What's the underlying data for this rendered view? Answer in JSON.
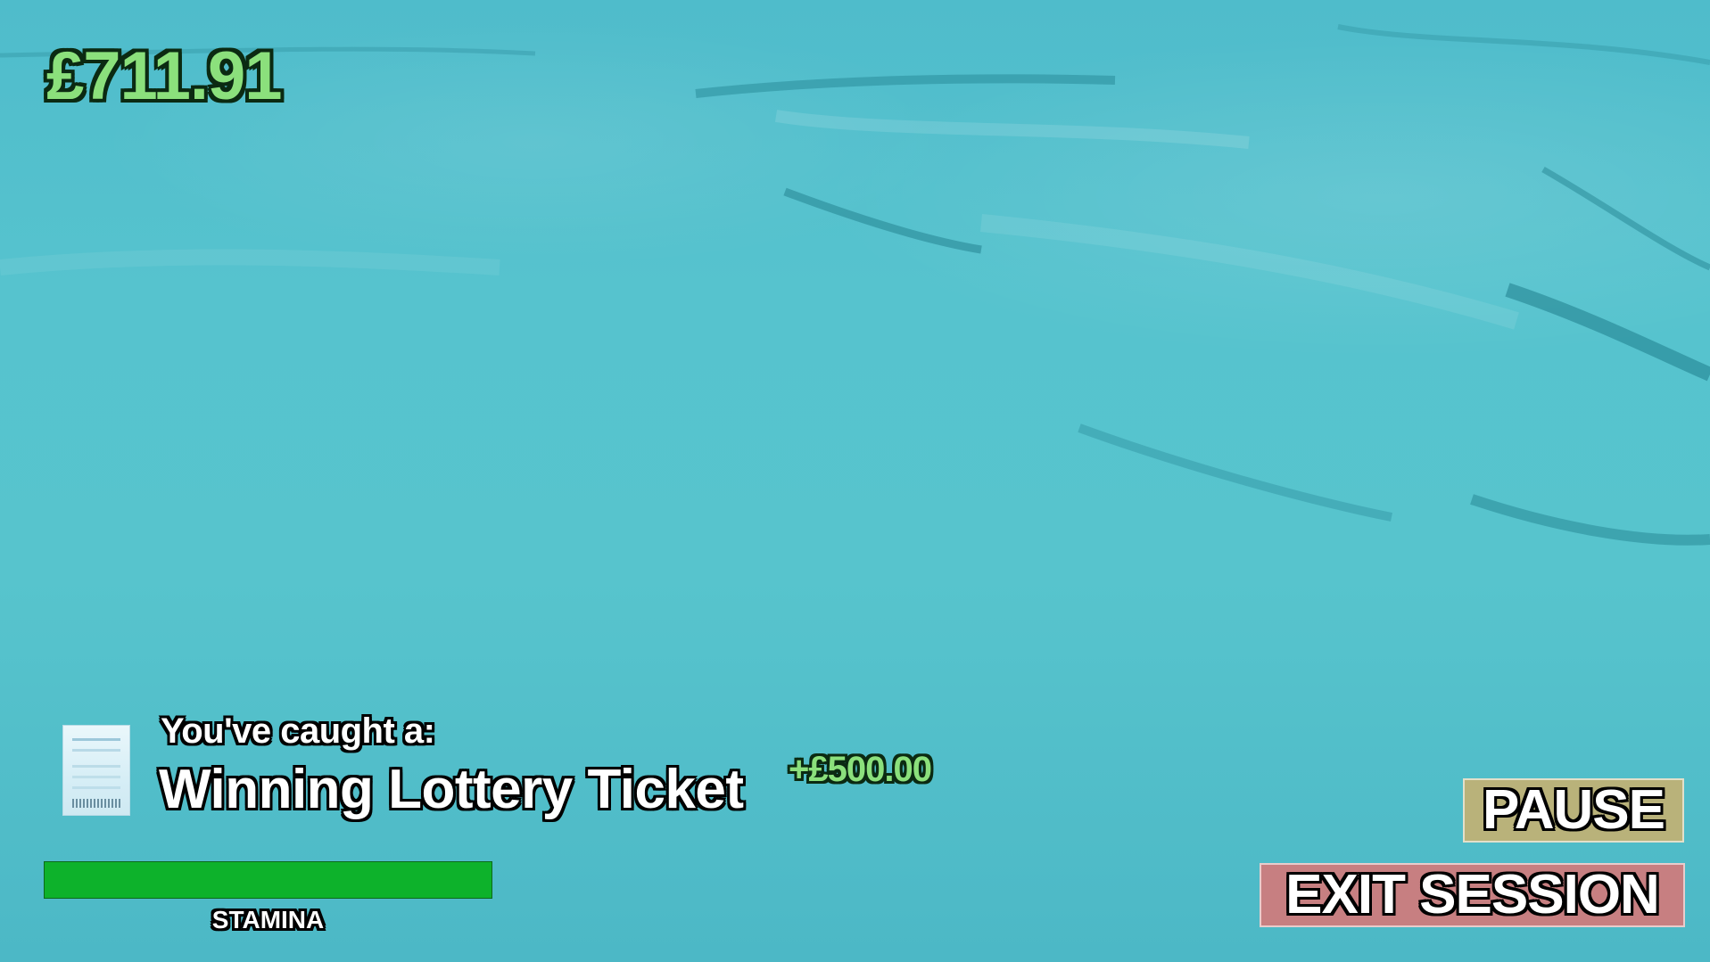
{
  "hud": {
    "money": "£711.91"
  },
  "catch": {
    "label": "You've caught a:",
    "item_name": "Winning Lottery Ticket",
    "reward": "+£500.00",
    "icon": "lottery-ticket-icon"
  },
  "stamina": {
    "label": "STAMINA",
    "level": 1.0,
    "bar_color": "#0db22b"
  },
  "buttons": {
    "pause_label": "PAUSE",
    "pause_color": "#b9b27a",
    "exit_label": "EXIT SESSION",
    "exit_color": "#c77f81"
  },
  "theme": {
    "water_color": "#57c4cd",
    "money_color": "#8be07c"
  }
}
